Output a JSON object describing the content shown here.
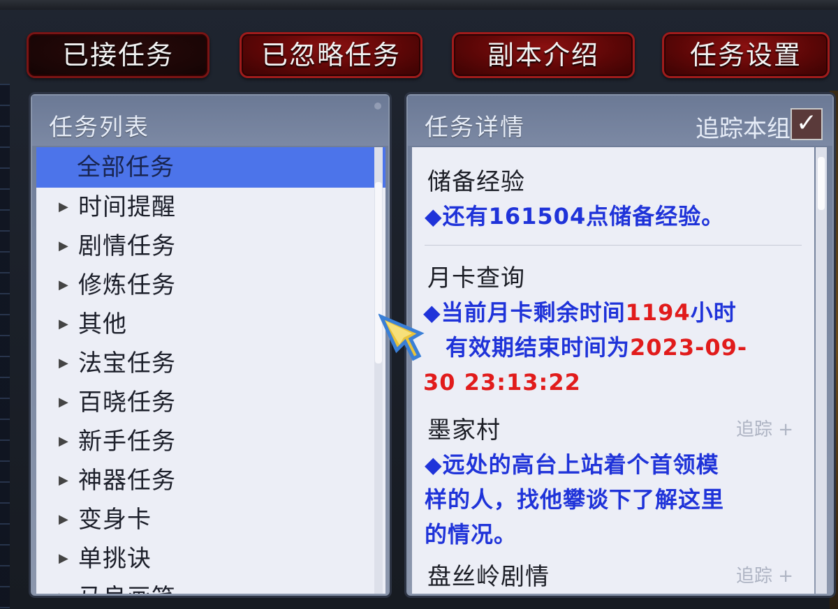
{
  "tabs": [
    {
      "label": "已接任务",
      "active": true
    },
    {
      "label": "已忽略任务",
      "active": false
    },
    {
      "label": "副本介绍",
      "active": false
    },
    {
      "label": "任务设置",
      "active": false
    }
  ],
  "task_list": {
    "title": "任务列表",
    "items": [
      {
        "label": "全部任务",
        "selected": true
      },
      {
        "label": "时间提醒"
      },
      {
        "label": "剧情任务"
      },
      {
        "label": "修炼任务"
      },
      {
        "label": "其他"
      },
      {
        "label": "法宝任务"
      },
      {
        "label": "百晓任务"
      },
      {
        "label": "新手任务"
      },
      {
        "label": "神器任务"
      },
      {
        "label": "变身卡"
      },
      {
        "label": "单挑诀"
      },
      {
        "label": "马良画笔"
      }
    ]
  },
  "task_detail": {
    "title": "任务详情",
    "track_group_label": "追踪本组",
    "track_group_checked": true,
    "check_glyph": "✓",
    "sections": [
      {
        "title": "储备经验",
        "text_prefix": "◆还有161504点储备经验。"
      },
      {
        "title": "月卡查询",
        "line1_prefix": "◆当前月卡剩余时间",
        "line1_value": "1194",
        "line1_suffix": "小时",
        "line2_prefix": "有效期结束时间为",
        "line2_value": "2023-09-",
        "line3_value": "30 23:13:22"
      },
      {
        "title": "墨家村",
        "track_label": "追踪 +",
        "line1": "◆远处的高台上站着个首领模",
        "line2": "样的人，找他攀谈下了解这里",
        "line3": "的情况。"
      },
      {
        "title": "盘丝岭剧情",
        "track_label": "追踪 +"
      }
    ]
  },
  "colors": {
    "tab_red": "#8a1010",
    "selected_blue": "#4c74ea",
    "text_blue": "#1f33d9",
    "text_red": "#e11b1b"
  }
}
